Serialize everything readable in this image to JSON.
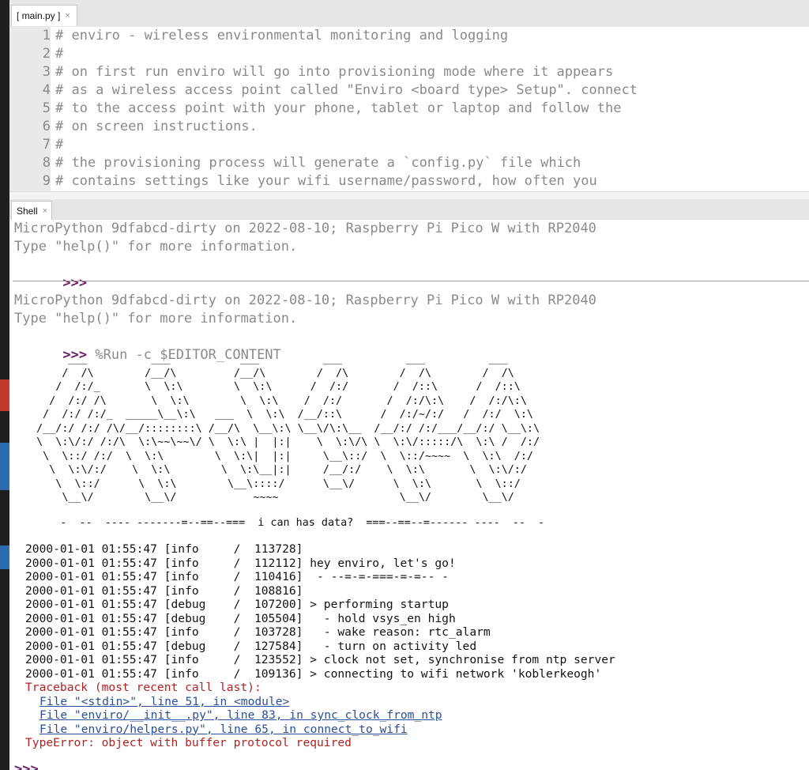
{
  "editor_tab": {
    "label": "[ main.py ]",
    "close": "×"
  },
  "editor": {
    "line_numbers": [
      "1",
      "2",
      "3",
      "4",
      "5",
      "6",
      "7",
      "8",
      "9"
    ],
    "lines": [
      "# enviro - wireless environmental monitoring and logging",
      "#",
      "# on first run enviro will go into provisioning mode where it appears",
      "# as a wireless access point called \"Enviro <board type> Setup\". connect",
      "# to the access point with your phone, tablet or laptop and follow the",
      "# on screen instructions.",
      "#",
      "# the provisioning process will generate a `config.py` file which",
      "# contains settings like your wifi username/password, how often you"
    ]
  },
  "shell_tab": {
    "label": "Shell",
    "close": "×"
  },
  "shell": {
    "banner1_line1": "MicroPython 9dfabcd-dirty on 2022-08-10; Raspberry Pi Pico W with RP2040",
    "banner1_line2": "Type \"help()\" for more information.",
    "prompt_symbol": ">>>",
    "banner2_line1": "MicroPython 9dfabcd-dirty on 2022-08-10; Raspberry Pi Pico W with RP2040",
    "banner2_line2": "Type \"help()\" for more information.",
    "run_command": " %Run -c $EDITOR_CONTENT",
    "ascii_art": "       ___          ___           ___          ___          ___          ___\n      /  /\\        /__/\\         /__/\\        /  /\\        /  /\\        /  /\\\n     /  /:/_       \\  \\:\\        \\  \\:\\      /  /:/       /  /::\\      /  /::\\\n    /  /:/ /\\       \\  \\:\\        \\  \\:\\    /  /:/       /  /:/\\:\\    /  /:/\\:\\\n   /  /:/ /:/_  _____\\__\\:\\   ___  \\  \\:\\  /__/::\\      /  /:/~/:/   /  /:/  \\:\\\n  /__/:/ /:/ /\\/__/::::::::\\ /__/\\  \\__\\:\\ \\__\\/\\:\\__  /__/:/ /:/___/__/:/ \\__\\:\\\n  \\  \\:\\/:/ /:/\\  \\:\\~~\\~~\\/ \\  \\:\\ |  |:|    \\  \\:\\/\\ \\  \\:\\/:::::/\\  \\:\\ /  /:/\n   \\  \\::/ /:/  \\  \\:\\        \\  \\:\\|  |:|     \\__\\::/  \\  \\::/~~~~  \\  \\:\\  /:/\n    \\  \\:\\/:/    \\  \\:\\        \\  \\:\\__|:|     /__/:/    \\  \\:\\       \\  \\:\\/:/\n     \\  \\::/      \\  \\:\\        \\__\\::::/      \\__\\/      \\  \\:\\       \\  \\::/\n      \\__\\/        \\__\\/            ~~~~                   \\__\\/        \\__\\/",
    "tagline": "      -  --  ---- -------=--==--===  i can has data?  ===--==--=------ ----  --  -",
    "log": [
      "2000-01-01 01:55:47 [info     /  113728]",
      "2000-01-01 01:55:47 [info     /  112112] hey enviro, let's go!",
      "2000-01-01 01:55:47 [info     /  110416]  - --=-=-===-=-=-- -",
      "2000-01-01 01:55:47 [info     /  108816]",
      "2000-01-01 01:55:47 [debug    /  107200] > performing startup",
      "2000-01-01 01:55:47 [debug    /  105504]   - hold vsys_en high",
      "2000-01-01 01:55:47 [info     /  103728]   - wake reason: rtc_alarm",
      "2000-01-01 01:55:47 [debug    /  127584]   - turn on activity led",
      "2000-01-01 01:55:47 [info     /  123552] > clock not set, synchronise from ntp server",
      "2000-01-01 01:55:47 [info     /  109136] > connecting to wifi network 'koblerkeogh'"
    ],
    "traceback_header": "Traceback (most recent call last):",
    "traceback_frames": [
      "File \"<stdin>\", line 51, in <module>",
      "File \"enviro/__init__.py\", line 83, in sync_clock_from_ntp",
      "File \"enviro/helpers.py\", line 65, in connect_to_wifi"
    ],
    "error": "TypeError: object with buffer protocol required",
    "final_prompt": ">>>"
  },
  "colors": {
    "comment": "#8a8a8a",
    "prompt": "#6a1b6a",
    "error": "#b22222",
    "link": "#2a4f9a",
    "gutter": "#e9e9e9"
  }
}
